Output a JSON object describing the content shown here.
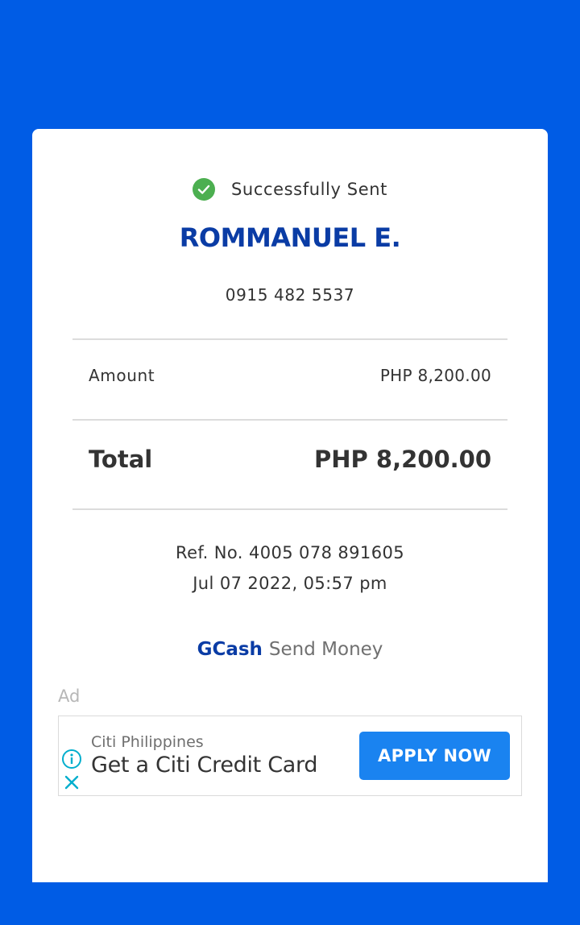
{
  "status": {
    "text": "Successfully Sent",
    "icon": "check-circle-icon",
    "color": "#4caf50"
  },
  "recipient": {
    "name": "ROMMANUEL E.",
    "number": "0915 482 5537"
  },
  "breakdown": {
    "amount_label": "Amount",
    "amount_value": "PHP 8,200.00",
    "total_label": "Total",
    "total_value": "PHP 8,200.00"
  },
  "transaction": {
    "ref_no": "Ref. No. 4005 078 891605",
    "datetime": "Jul 07 2022, 05:57 pm"
  },
  "footer": {
    "brand": "GCash",
    "service": "Send Money"
  },
  "ad": {
    "label": "Ad",
    "advertiser": "Citi Philippines",
    "headline": "Get a Citi Credit Card",
    "cta": "APPLY NOW",
    "info_icon": "info-icon",
    "close_icon": "close-icon"
  },
  "colors": {
    "background": "#005ce5",
    "brand_blue": "#0a3ca5",
    "cta_blue": "#1a83f0"
  }
}
